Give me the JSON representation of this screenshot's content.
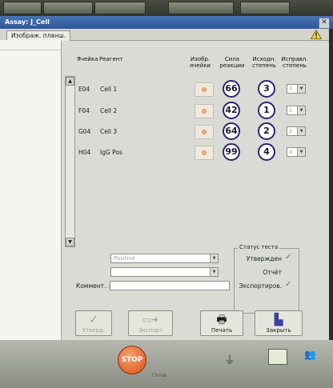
{
  "window": {
    "title": "Assay: J_Cell",
    "close_icon": "close-icon"
  },
  "tab": {
    "label": "Изображ. планш."
  },
  "columns": {
    "well": "Ячейка",
    "reagent": "Реагент",
    "image": "Изобр. ячейки",
    "strength": "Сила реакции",
    "initial": "Исходн. степень",
    "corrected": "Исправл. степень"
  },
  "rows": [
    {
      "well": "E04",
      "reagent": "Cell 1",
      "strength": "66",
      "initial": "3",
      "corrected": "3"
    },
    {
      "well": "F04",
      "reagent": "Cell 2",
      "strength": "42",
      "initial": "1",
      "corrected": "1"
    },
    {
      "well": "G04",
      "reagent": "Cell 3",
      "strength": "64",
      "initial": "2",
      "corrected": "2"
    },
    {
      "well": "H04",
      "reagent": "IgG Pos",
      "strength": "99",
      "initial": "4",
      "corrected": "4"
    }
  ],
  "result": {
    "value": "Positive",
    "second": ""
  },
  "comment": {
    "label": "Коммент. :",
    "value": ""
  },
  "status": {
    "legend": "Статус теста",
    "approved": "Утвержден",
    "report": "Отчёт",
    "exported": "Экспортиров."
  },
  "buttons": {
    "approve": "Утверд.",
    "export": "Экспорт",
    "print": "Печать",
    "close": "Закрыть"
  },
  "bottom": {
    "stop": "STOP",
    "small": "Готов"
  },
  "colors": {
    "accent": "#2b2672",
    "check": "#3b9a2c",
    "titlebar": "#3a64a6"
  }
}
